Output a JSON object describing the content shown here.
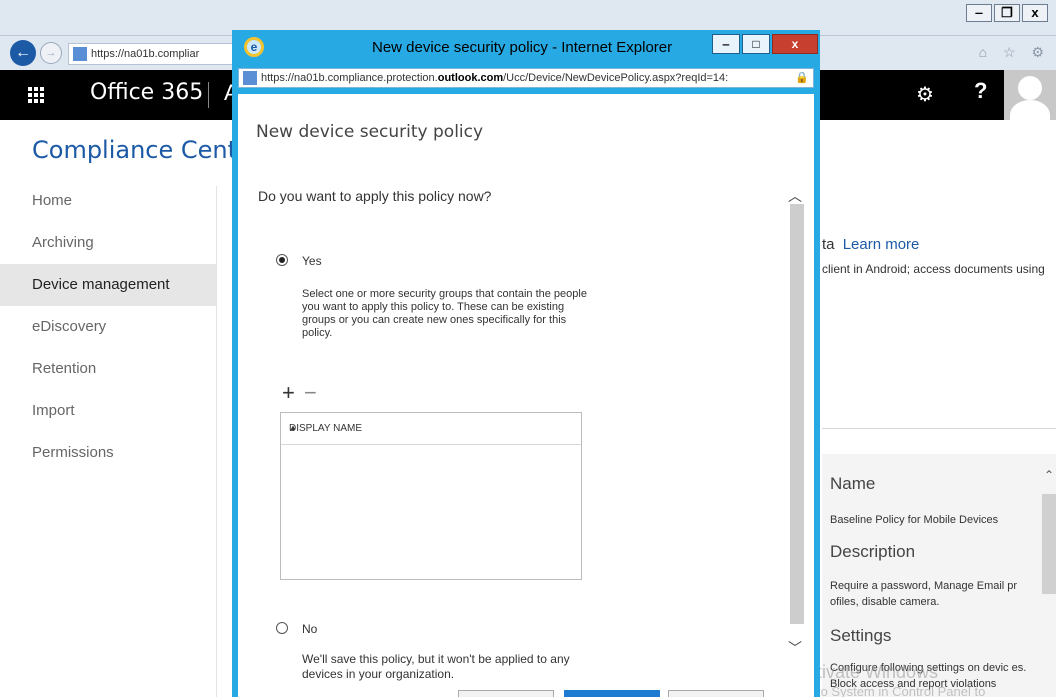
{
  "browser": {
    "url_short": "https://na01b.compliar",
    "window_ctrls": {
      "minimize": "‒",
      "restore": "❐",
      "close": "x"
    },
    "tools": "⌂ ☆ ⚙"
  },
  "o365": {
    "title": "Office 365",
    "cut_letter": "A",
    "help": "?"
  },
  "compliance": {
    "title": "Compliance Center",
    "nav": [
      {
        "label": "Home"
      },
      {
        "label": "Archiving"
      },
      {
        "label": "Device management"
      },
      {
        "label": "eDiscovery"
      },
      {
        "label": "Retention"
      },
      {
        "label": "Import"
      },
      {
        "label": "Permissions"
      }
    ]
  },
  "right_panel": {
    "frag1_prefix": "ta",
    "learn_more": "Learn more",
    "frag2": "client in Android; access documents using",
    "name_heading": "Name",
    "name_value": "Baseline Policy for Mobile Devices",
    "desc_heading": "Description",
    "desc_value": "Require a password, Manage Email pr ofiles, disable camera.",
    "settings_heading": "Settings",
    "settings_value": "Configure following settings on devic es. Block access and report violations"
  },
  "watermark": {
    "line1": "Activate Windows",
    "line2": "Go to System in Control Panel to"
  },
  "popup": {
    "title": "New device security policy - Internet Explorer",
    "url_prefix": "https://na01b.compliance.protection.",
    "url_bold": "outlook.com",
    "url_suffix": "/Ucc/Device/NewDevicePolicy.aspx?reqId=14:",
    "heading": "New device security policy",
    "question": "Do you want to apply this policy now?",
    "yes_label": "Yes",
    "yes_selected": true,
    "yes_description": "Select one or more security groups that contain the people you want to apply this policy to. These can be existing groups or you can create new ones specifically for this policy.",
    "add": "+",
    "remove": "−",
    "column_header": "DISPLAY NAME",
    "no_label": "No",
    "no_description": "We'll save this policy, but it won't be applied to any devices in your organization."
  }
}
